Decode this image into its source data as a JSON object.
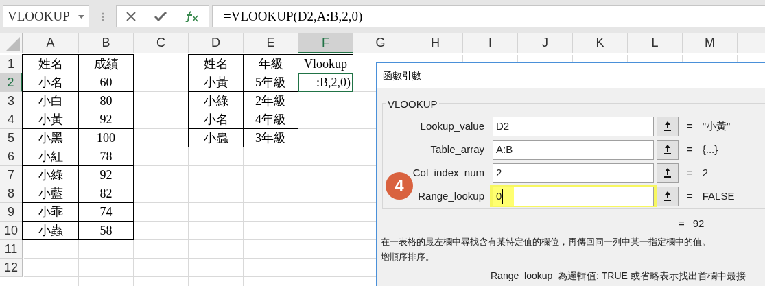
{
  "name_box": {
    "value": "VLOOKUP"
  },
  "formula_bar": {
    "value": "=VLOOKUP(D2,A:B,2,0)"
  },
  "columns": [
    {
      "label": "A",
      "selected": false
    },
    {
      "label": "B",
      "selected": false
    },
    {
      "label": "C",
      "selected": false
    },
    {
      "label": "D",
      "selected": false
    },
    {
      "label": "E",
      "selected": false
    },
    {
      "label": "F",
      "selected": true
    },
    {
      "label": "G",
      "selected": false
    },
    {
      "label": "H",
      "selected": false
    },
    {
      "label": "I",
      "selected": false
    },
    {
      "label": "J",
      "selected": false
    },
    {
      "label": "K",
      "selected": false
    },
    {
      "label": "L",
      "selected": false
    },
    {
      "label": "M",
      "selected": false
    }
  ],
  "row_headers": [
    {
      "number": "1",
      "selected": false
    },
    {
      "number": "2",
      "selected": true
    },
    {
      "number": "3",
      "selected": false
    },
    {
      "number": "4",
      "selected": false
    },
    {
      "number": "5",
      "selected": false
    },
    {
      "number": "6",
      "selected": false
    },
    {
      "number": "7",
      "selected": false
    },
    {
      "number": "8",
      "selected": false
    },
    {
      "number": "9",
      "selected": false
    },
    {
      "number": "10",
      "selected": false
    },
    {
      "number": "11",
      "selected": false
    },
    {
      "number": "12",
      "selected": false
    }
  ],
  "score_table": [
    [
      "姓名",
      "成績"
    ],
    [
      "小名",
      "60"
    ],
    [
      "小白",
      "80"
    ],
    [
      "小黃",
      "92"
    ],
    [
      "小黑",
      "100"
    ],
    [
      "小紅",
      "78"
    ],
    [
      "小綠",
      "92"
    ],
    [
      "小藍",
      "82"
    ],
    [
      "小乖",
      "74"
    ],
    [
      "小蟲",
      "58"
    ]
  ],
  "grade_table": [
    [
      "姓名",
      "年級"
    ],
    [
      "小黃",
      "5年級"
    ],
    [
      "小綠",
      "2年級"
    ],
    [
      "小名",
      "4年級"
    ],
    [
      "小蟲",
      "3年級"
    ]
  ],
  "lookup_column": [
    {
      "text": "Vlookup",
      "selected": false
    },
    {
      "text": ":B,2,0)",
      "selected": true
    }
  ],
  "dialog": {
    "title": "函數引數",
    "function_name": "VLOOKUP",
    "arguments": [
      {
        "label": "Lookup_value",
        "value": "D2",
        "equals": "=",
        "result": "\"小黃\"",
        "highlighted": false
      },
      {
        "label": "Table_array",
        "value": "A:B",
        "equals": "=",
        "result": "{...}",
        "highlighted": false
      },
      {
        "label": "Col_index_num",
        "value": "2",
        "equals": "=",
        "result": "2",
        "highlighted": false
      },
      {
        "label": "Range_lookup",
        "value": "0",
        "equals": "=",
        "result": "FALSE",
        "highlighted": true
      }
    ],
    "formula_equals": "=",
    "formula_result": "92",
    "description_lines": [
      "在一表格的最左欄中尋找含有某特定值的欄位，再傳回同一列中某一指定欄中的值。",
      "增順序排序。"
    ],
    "help_label": "Range_lookup",
    "help_text": "為邏輯值: TRUE 或省略表示找出首欄中最接"
  },
  "step_badge": {
    "text": "4"
  }
}
